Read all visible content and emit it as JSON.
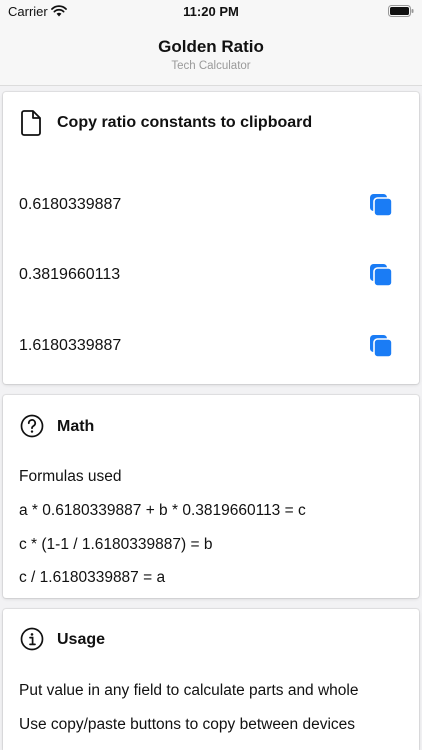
{
  "status": {
    "carrier": "Carrier",
    "time": "11:20 PM"
  },
  "nav": {
    "title": "Golden Ratio",
    "subtitle": "Tech Calculator"
  },
  "copy_section": {
    "title": "Copy ratio constants to clipboard",
    "icon": "document-icon",
    "constants": [
      "0.6180339887",
      "0.3819660113",
      "1.6180339887"
    ]
  },
  "math_section": {
    "title": "Math",
    "icon": "question-circle-icon",
    "lines": [
      "Formulas used",
      "a * 0.6180339887 + b * 0.3819660113 = c",
      "c * (1-1 / 1.6180339887) = b",
      "c / 1.6180339887 = a"
    ]
  },
  "usage_section": {
    "title": "Usage",
    "icon": "info-circle-icon",
    "lines": [
      "Put value in any field to calculate parts and whole",
      "Use copy/paste buttons to copy between devices"
    ]
  },
  "colors": {
    "accent": "#1a7cf5",
    "background": "#f2f2f4",
    "card": "#ffffff"
  }
}
